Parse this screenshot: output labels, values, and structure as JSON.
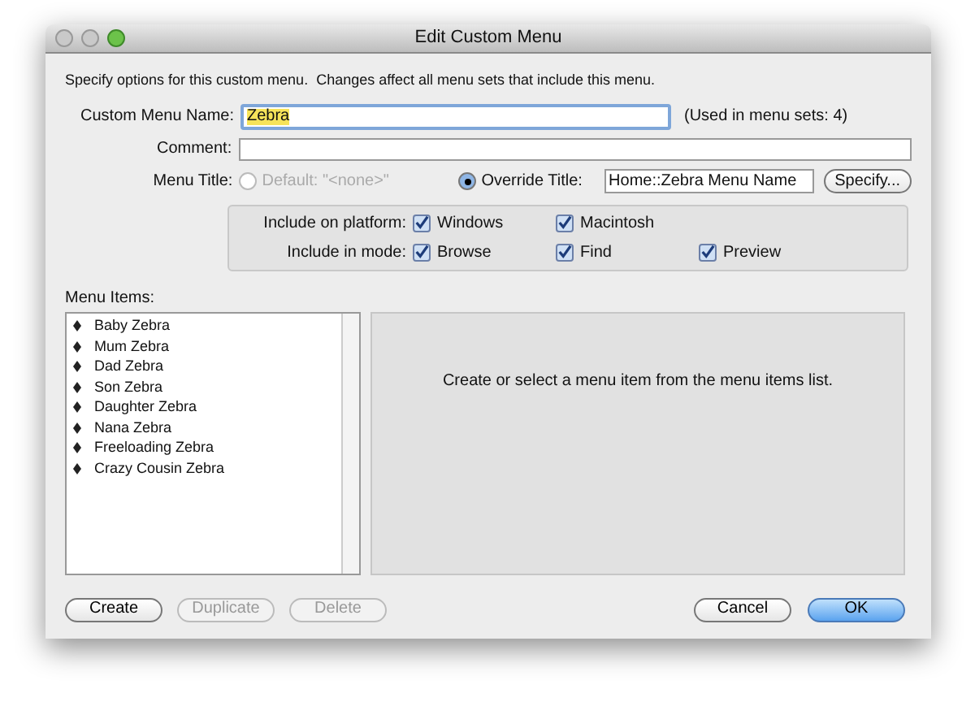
{
  "window": {
    "title": "Edit Custom Menu"
  },
  "instructions": "Specify options for this custom menu.  Changes affect all menu sets that include this menu.",
  "name_field": {
    "label": "Custom Menu Name:",
    "value": "Zebra",
    "usage": "(Used in menu sets: 4)"
  },
  "comment_field": {
    "label": "Comment:"
  },
  "menu_title": {
    "label": "Menu Title:",
    "options": [
      {
        "label": "Default: \"<none>\"",
        "selected": false,
        "disabled": true
      },
      {
        "label": "Override Title:",
        "selected": true,
        "disabled": false
      }
    ],
    "value": "Home::Zebra Menu Name",
    "button": "Specify..."
  },
  "include": [
    {
      "label": "Include on platform:",
      "options": [
        {
          "label": "Windows",
          "checked": true
        },
        {
          "label": "Macintosh",
          "checked": true
        }
      ]
    },
    {
      "label": "Include in mode:",
      "options": [
        {
          "label": "Browse",
          "checked": true
        },
        {
          "label": "Find",
          "checked": true
        },
        {
          "label": "Preview",
          "checked": true
        }
      ]
    }
  ],
  "menu_items": {
    "label": "Menu Items:",
    "items": [
      "Baby Zebra",
      "Mum Zebra",
      "Dad Zebra",
      "Son Zebra",
      "Daughter Zebra",
      "Nana Zebra",
      "Freeloading Zebra",
      "Crazy Cousin Zebra"
    ]
  },
  "detail_message": "Create or select a menu item from the menu items list.",
  "left_buttons": [
    {
      "label": "Create",
      "disabled": false
    },
    {
      "label": "Duplicate",
      "disabled": true
    },
    {
      "label": "Delete",
      "disabled": true
    }
  ],
  "right_buttons": [
    {
      "label": "Cancel",
      "default": false
    },
    {
      "label": "OK",
      "default": true
    }
  ]
}
